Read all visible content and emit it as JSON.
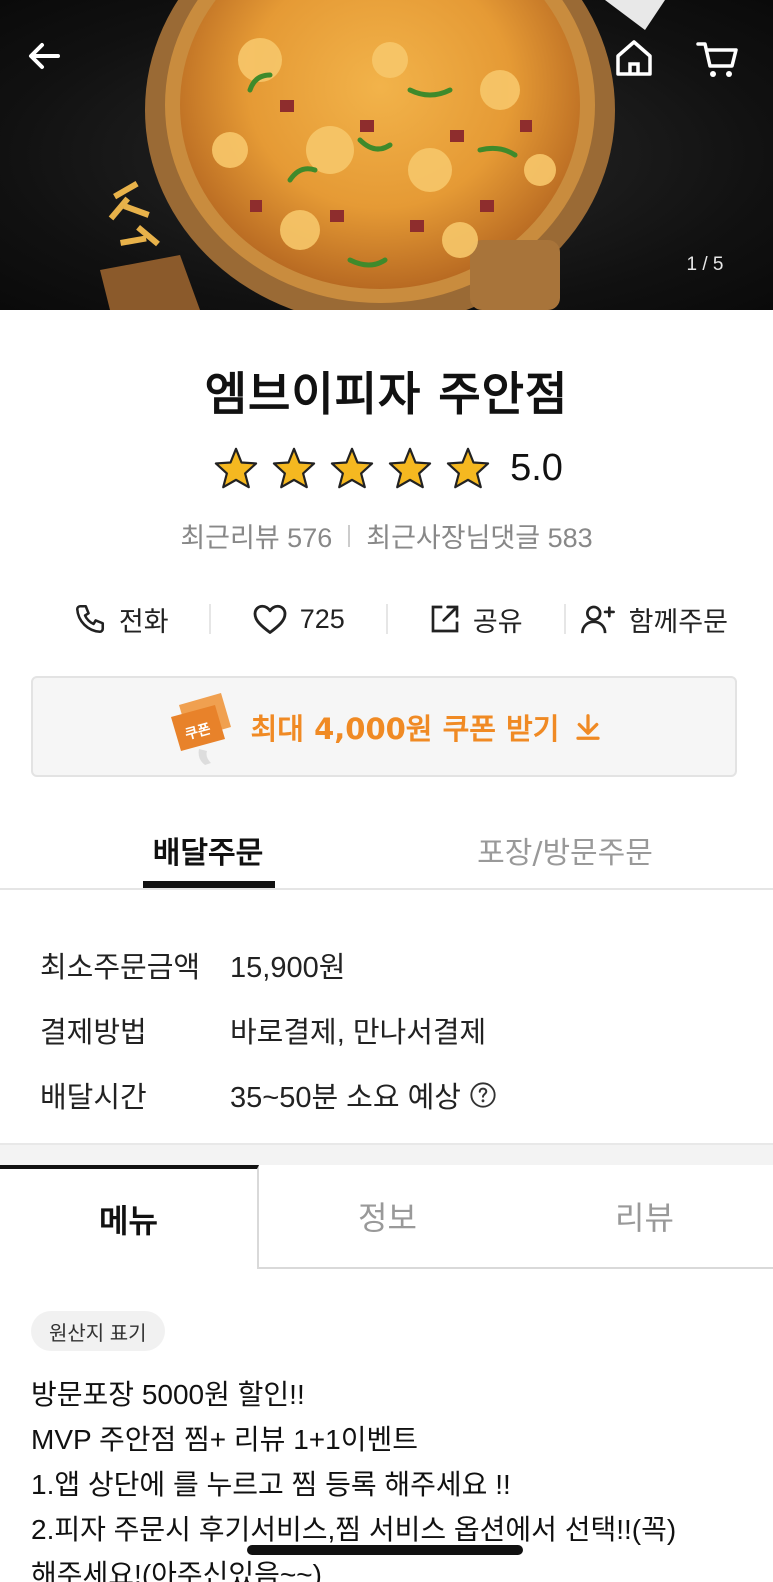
{
  "hero": {
    "image_counter": "1 / 5",
    "icons": {
      "back": "back-arrow-icon",
      "home": "home-icon",
      "cart": "cart-icon"
    }
  },
  "store": {
    "name": "엠브이피자 주안점",
    "rating": "5.0",
    "stars_filled": 5,
    "recent_reviews_label": "최근리뷰 576",
    "owner_replies_label": "최근사장님댓글 583"
  },
  "actions": {
    "call": "전화",
    "likes": "725",
    "share": "공유",
    "group_order": "함께주문"
  },
  "coupon": {
    "badge": "쿠폰",
    "label": "최대 4,000원 쿠폰 받기"
  },
  "order_tabs": {
    "delivery": "배달주문",
    "pickup": "포장/방문주문",
    "active": "delivery"
  },
  "info": {
    "min_order_label": "최소주문금액",
    "min_order_value": "15,900원",
    "payment_label": "결제방법",
    "payment_value": "바로결제, 만나서결제",
    "delivery_time_label": "배달시간",
    "delivery_time_value": "35~50분 소요 예상"
  },
  "menu_tabs": {
    "menu": "메뉴",
    "info": "정보",
    "review": "리뷰",
    "active": "menu"
  },
  "notice": {
    "origin_badge": "원산지 표기",
    "lines": [
      "방문포장 5000원 할인!!",
      "MVP 주안점 찜+ 리뷰 1+1이벤트",
      "1.앱 상단에 를 누르고 찜 등록 해주세요 !!",
      "2.피자 주문시 후기서비스,찜 서비스 옵션에서 선택!!(꼭)",
      "해주세요!(아주신있음~~)"
    ]
  },
  "colors": {
    "accent_orange": "#f08a24",
    "star_gold": "#f5b820",
    "text_dark": "#111111",
    "text_muted": "#888888"
  }
}
